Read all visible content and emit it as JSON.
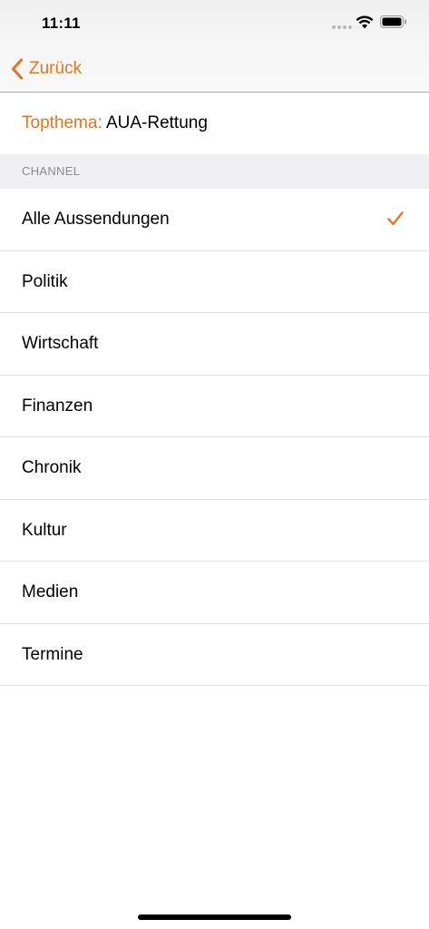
{
  "status_bar": {
    "time": "11:11"
  },
  "nav": {
    "back_label": "Zurück",
    "back_icon": "chevron-left-icon"
  },
  "topic": {
    "prefix": "Topthema:",
    "value": "AUA-Rettung"
  },
  "section": {
    "header": "CHANNEL"
  },
  "channels": [
    {
      "label": "Alle Aussendungen",
      "selected": true
    },
    {
      "label": "Politik",
      "selected": false
    },
    {
      "label": "Wirtschaft",
      "selected": false
    },
    {
      "label": "Finanzen",
      "selected": false
    },
    {
      "label": "Chronik",
      "selected": false
    },
    {
      "label": "Kultur",
      "selected": false
    },
    {
      "label": "Medien",
      "selected": false
    },
    {
      "label": "Termine",
      "selected": false
    }
  ],
  "colors": {
    "accent": "#e8751a",
    "section_background": "#efeff4",
    "section_text": "#8a8a8e",
    "separator": "#e0e0e3"
  }
}
